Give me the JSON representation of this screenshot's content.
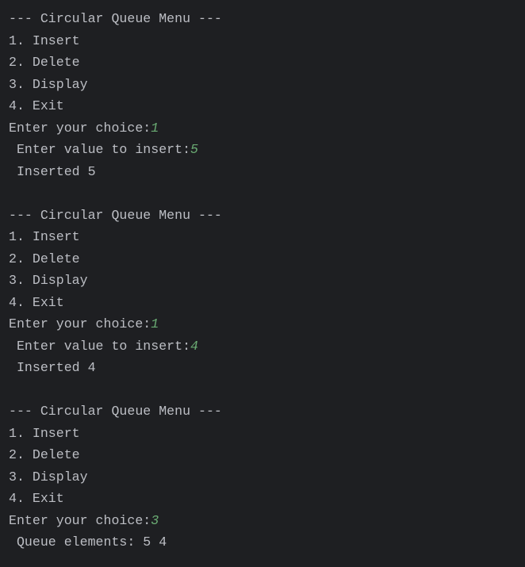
{
  "colors": {
    "background": "#1e1f22",
    "text": "#bcbec4",
    "user_input": "#6aab73"
  },
  "console": {
    "lines": [
      {
        "text": "--- Circular Queue Menu ---"
      },
      {
        "text": "1. Insert"
      },
      {
        "text": "2. Delete"
      },
      {
        "text": "3. Display"
      },
      {
        "text": "4. Exit"
      },
      {
        "text": "Enter your choice:",
        "input": "1"
      },
      {
        "text": " Enter value to insert:",
        "input": "5"
      },
      {
        "text": " Inserted 5"
      },
      {
        "text": ""
      },
      {
        "text": "--- Circular Queue Menu ---"
      },
      {
        "text": "1. Insert"
      },
      {
        "text": "2. Delete"
      },
      {
        "text": "3. Display"
      },
      {
        "text": "4. Exit"
      },
      {
        "text": "Enter your choice:",
        "input": "1"
      },
      {
        "text": " Enter value to insert:",
        "input": "4"
      },
      {
        "text": " Inserted 4"
      },
      {
        "text": ""
      },
      {
        "text": "--- Circular Queue Menu ---"
      },
      {
        "text": "1. Insert"
      },
      {
        "text": "2. Delete"
      },
      {
        "text": "3. Display"
      },
      {
        "text": "4. Exit"
      },
      {
        "text": "Enter your choice:",
        "input": "3"
      },
      {
        "text": " Queue elements: 5 4"
      }
    ]
  }
}
